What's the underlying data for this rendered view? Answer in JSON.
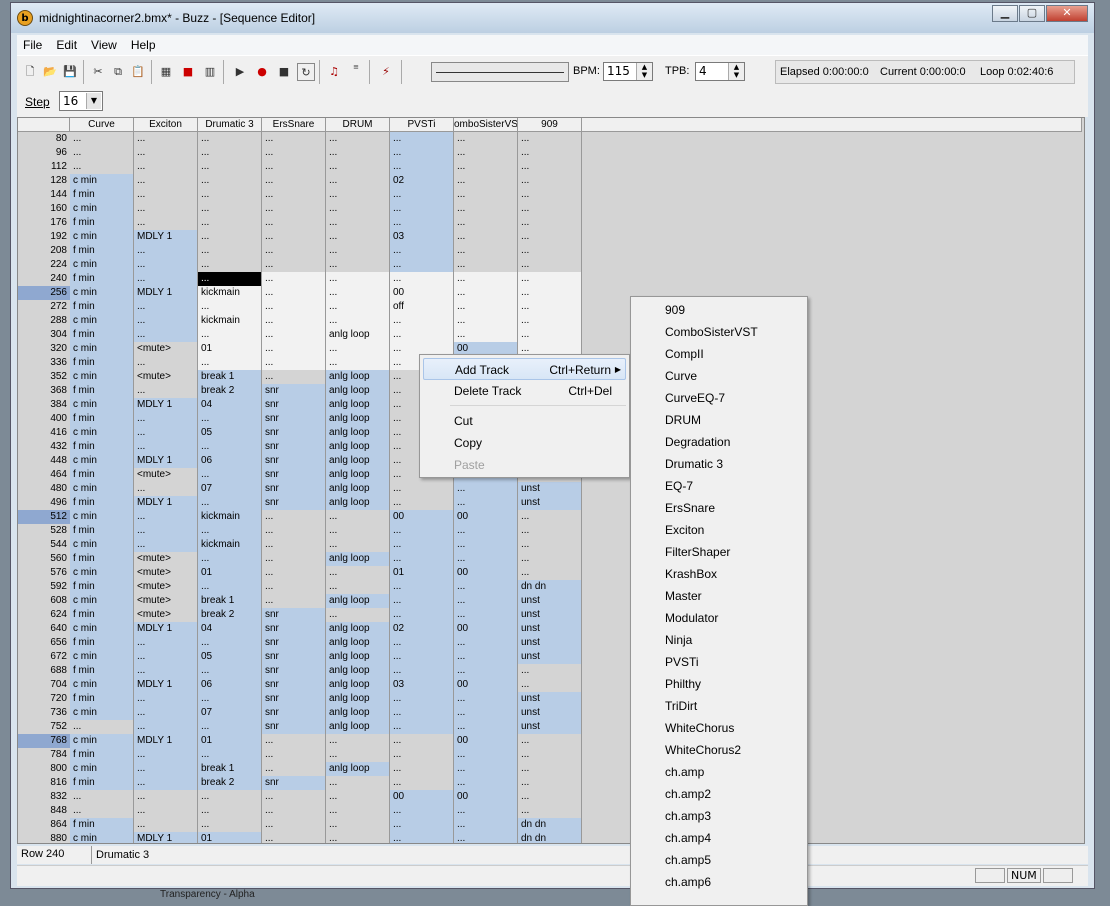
{
  "window": {
    "title": "midnightinacorner2.bmx* - Buzz - [Sequence Editor]",
    "app_icon_letter": "b",
    "minimize": "▁",
    "maximize": "▢",
    "close": "✕"
  },
  "menu": [
    "File",
    "Edit",
    "View",
    "Help"
  ],
  "toolbar": {
    "bpm_label": "BPM:",
    "bpm_value": "115",
    "tpb_label": "TPB:",
    "tpb_value": "4",
    "elapsed": "Elapsed 0:00:00:0",
    "current": "Current 0:00:00:0",
    "loop": "Loop 0:02:40:6"
  },
  "step": {
    "label": "Step",
    "value": "16"
  },
  "columns": [
    "Curve",
    "Exciton",
    "Drumatic 3",
    "ErsSnare",
    "DRUM",
    "PVSTi",
    "omboSisterVS",
    "909"
  ],
  "rows": [
    {
      "n": "80",
      "c": [
        "...",
        "...",
        "...",
        "...",
        "...",
        "...",
        "...",
        "..."
      ],
      "s": [
        "g",
        "g",
        "g",
        "g",
        "g",
        "b",
        "g",
        "g"
      ]
    },
    {
      "n": "96",
      "c": [
        "...",
        "...",
        "...",
        "...",
        "...",
        "...",
        "...",
        "..."
      ],
      "s": [
        "g",
        "g",
        "g",
        "g",
        "g",
        "b",
        "g",
        "g"
      ]
    },
    {
      "n": "112",
      "c": [
        "...",
        "...",
        "...",
        "...",
        "...",
        "...",
        "...",
        "..."
      ],
      "s": [
        "g",
        "g",
        "g",
        "g",
        "g",
        "b",
        "g",
        "g"
      ]
    },
    {
      "n": "128",
      "c": [
        "c min",
        "...",
        "...",
        "...",
        "...",
        "02",
        "...",
        "..."
      ],
      "s": [
        "b",
        "g",
        "g",
        "g",
        "g",
        "b",
        "g",
        "g"
      ]
    },
    {
      "n": "144",
      "c": [
        "f min",
        "...",
        "...",
        "...",
        "...",
        "...",
        "...",
        "..."
      ],
      "s": [
        "b",
        "g",
        "g",
        "g",
        "g",
        "b",
        "g",
        "g"
      ]
    },
    {
      "n": "160",
      "c": [
        "c min",
        "...",
        "...",
        "...",
        "...",
        "...",
        "...",
        "..."
      ],
      "s": [
        "b",
        "g",
        "g",
        "g",
        "g",
        "b",
        "g",
        "g"
      ]
    },
    {
      "n": "176",
      "c": [
        "f min",
        "...",
        "...",
        "...",
        "...",
        "...",
        "...",
        "..."
      ],
      "s": [
        "b",
        "g",
        "g",
        "g",
        "g",
        "b",
        "g",
        "g"
      ]
    },
    {
      "n": "192",
      "c": [
        "c min",
        "MDLY 1",
        "...",
        "...",
        "...",
        "03",
        "...",
        "..."
      ],
      "s": [
        "b",
        "b",
        "g",
        "g",
        "g",
        "b",
        "g",
        "g"
      ]
    },
    {
      "n": "208",
      "c": [
        "f min",
        "...",
        "...",
        "...",
        "...",
        "...",
        "...",
        "..."
      ],
      "s": [
        "b",
        "b",
        "g",
        "g",
        "g",
        "b",
        "g",
        "g"
      ]
    },
    {
      "n": "224",
      "c": [
        "c min",
        "...",
        "...",
        "...",
        "...",
        "...",
        "...",
        "..."
      ],
      "s": [
        "b",
        "b",
        "g",
        "g",
        "g",
        "b",
        "g",
        "g"
      ]
    },
    {
      "n": "240",
      "c": [
        "f min",
        "...",
        "...",
        "...",
        "...",
        "...",
        "...",
        "..."
      ],
      "s": [
        "b",
        "b",
        "x",
        "w",
        "w",
        "w",
        "w",
        "w"
      ]
    },
    {
      "n": "256",
      "c": [
        "c min",
        "MDLY 1",
        "kickmain",
        "...",
        "...",
        "00",
        "...",
        "..."
      ],
      "s": [
        "b",
        "b",
        "w",
        "w",
        "w",
        "w",
        "w",
        "w"
      ],
      "hl": true
    },
    {
      "n": "272",
      "c": [
        "f min",
        "...",
        "...",
        "...",
        "...",
        "off",
        "...",
        "..."
      ],
      "s": [
        "b",
        "b",
        "w",
        "w",
        "w",
        "w",
        "w",
        "w"
      ]
    },
    {
      "n": "288",
      "c": [
        "c min",
        "...",
        "kickmain",
        "...",
        "...",
        "...",
        "...",
        "..."
      ],
      "s": [
        "b",
        "b",
        "w",
        "w",
        "w",
        "w",
        "w",
        "w"
      ]
    },
    {
      "n": "304",
      "c": [
        "f min",
        "...",
        "...",
        "...",
        "anlg loop",
        "...",
        "...",
        "..."
      ],
      "s": [
        "b",
        "b",
        "w",
        "w",
        "w",
        "w",
        "w",
        "w"
      ]
    },
    {
      "n": "320",
      "c": [
        "c min",
        "<mute>",
        "01",
        "...",
        "...",
        "...",
        "00",
        "..."
      ],
      "s": [
        "b",
        "g",
        "w",
        "w",
        "w",
        "w",
        "b",
        "w"
      ]
    },
    {
      "n": "336",
      "c": [
        "f min",
        "...",
        "...",
        "...",
        "...",
        "...",
        "...",
        "..."
      ],
      "s": [
        "b",
        "g",
        "w",
        "w",
        "w",
        "w",
        "b",
        "w"
      ]
    },
    {
      "n": "352",
      "c": [
        "c min",
        "<mute>",
        "break 1",
        "...",
        "anlg loop",
        "...",
        "...",
        "..."
      ],
      "s": [
        "b",
        "g",
        "b",
        "g",
        "b",
        "g",
        "b",
        "g"
      ]
    },
    {
      "n": "368",
      "c": [
        "f min",
        "...",
        "break 2",
        "snr",
        "anlg loop",
        "...",
        "...",
        "..."
      ],
      "s": [
        "b",
        "g",
        "b",
        "b",
        "b",
        "g",
        "b",
        "g"
      ]
    },
    {
      "n": "384",
      "c": [
        "c min",
        "MDLY 1",
        "04",
        "snr",
        "anlg loop",
        "...",
        "...",
        "..."
      ],
      "s": [
        "b",
        "b",
        "b",
        "b",
        "b",
        "g",
        "b",
        "g"
      ]
    },
    {
      "n": "400",
      "c": [
        "f min",
        "...",
        "...",
        "snr",
        "anlg loop",
        "...",
        "...",
        "..."
      ],
      "s": [
        "b",
        "b",
        "b",
        "b",
        "b",
        "g",
        "b",
        "g"
      ]
    },
    {
      "n": "416",
      "c": [
        "c min",
        "...",
        "05",
        "snr",
        "anlg loop",
        "...",
        "...",
        "..."
      ],
      "s": [
        "b",
        "b",
        "b",
        "b",
        "b",
        "g",
        "b",
        "g"
      ]
    },
    {
      "n": "432",
      "c": [
        "f min",
        "...",
        "...",
        "snr",
        "anlg loop",
        "...",
        "...",
        "..."
      ],
      "s": [
        "b",
        "b",
        "b",
        "b",
        "b",
        "g",
        "b",
        "g"
      ]
    },
    {
      "n": "448",
      "c": [
        "c min",
        "MDLY 1",
        "06",
        "snr",
        "anlg loop",
        "...",
        "...",
        "..."
      ],
      "s": [
        "b",
        "b",
        "b",
        "b",
        "b",
        "g",
        "b",
        "g"
      ]
    },
    {
      "n": "464",
      "c": [
        "f min",
        "<mute>",
        "...",
        "snr",
        "anlg loop",
        "...",
        "...",
        "..."
      ],
      "s": [
        "b",
        "g",
        "b",
        "b",
        "b",
        "g",
        "b",
        "g"
      ]
    },
    {
      "n": "480",
      "c": [
        "c min",
        "...",
        "07",
        "snr",
        "anlg loop",
        "...",
        "...",
        "unst"
      ],
      "s": [
        "b",
        "g",
        "b",
        "b",
        "b",
        "g",
        "b",
        "b"
      ]
    },
    {
      "n": "496",
      "c": [
        "f min",
        "MDLY 1",
        "...",
        "snr",
        "anlg loop",
        "...",
        "...",
        "unst"
      ],
      "s": [
        "b",
        "b",
        "b",
        "b",
        "b",
        "g",
        "b",
        "b"
      ]
    },
    {
      "n": "512",
      "c": [
        "c min",
        "...",
        "kickmain",
        "...",
        "...",
        "00",
        "00",
        "..."
      ],
      "s": [
        "b",
        "b",
        "b",
        "g",
        "g",
        "b",
        "b",
        "g"
      ],
      "hl": true
    },
    {
      "n": "528",
      "c": [
        "f min",
        "...",
        "...",
        "...",
        "...",
        "...",
        "...",
        "..."
      ],
      "s": [
        "b",
        "b",
        "b",
        "g",
        "g",
        "b",
        "b",
        "g"
      ]
    },
    {
      "n": "544",
      "c": [
        "c min",
        "...",
        "kickmain",
        "...",
        "...",
        "...",
        "...",
        "..."
      ],
      "s": [
        "b",
        "b",
        "b",
        "g",
        "g",
        "b",
        "b",
        "g"
      ]
    },
    {
      "n": "560",
      "c": [
        "f min",
        "<mute>",
        "...",
        "...",
        "anlg loop",
        "...",
        "...",
        "..."
      ],
      "s": [
        "b",
        "g",
        "b",
        "g",
        "b",
        "b",
        "b",
        "g"
      ]
    },
    {
      "n": "576",
      "c": [
        "c min",
        "<mute>",
        "01",
        "...",
        "...",
        "01",
        "00",
        "..."
      ],
      "s": [
        "b",
        "g",
        "b",
        "g",
        "g",
        "b",
        "b",
        "g"
      ]
    },
    {
      "n": "592",
      "c": [
        "f min",
        "<mute>",
        "...",
        "...",
        "...",
        "...",
        "...",
        "dn dn"
      ],
      "s": [
        "b",
        "g",
        "b",
        "g",
        "g",
        "b",
        "b",
        "b"
      ]
    },
    {
      "n": "608",
      "c": [
        "c min",
        "<mute>",
        "break 1",
        "...",
        "anlg loop",
        "...",
        "...",
        "unst"
      ],
      "s": [
        "b",
        "g",
        "b",
        "g",
        "b",
        "b",
        "b",
        "b"
      ]
    },
    {
      "n": "624",
      "c": [
        "f min",
        "<mute>",
        "break 2",
        "snr",
        "...",
        "...",
        "...",
        "unst"
      ],
      "s": [
        "b",
        "g",
        "b",
        "b",
        "g",
        "b",
        "b",
        "b"
      ]
    },
    {
      "n": "640",
      "c": [
        "c min",
        "MDLY 1",
        "04",
        "snr",
        "anlg loop",
        "02",
        "00",
        "unst"
      ],
      "s": [
        "b",
        "b",
        "b",
        "b",
        "b",
        "b",
        "b",
        "b"
      ]
    },
    {
      "n": "656",
      "c": [
        "f min",
        "...",
        "...",
        "snr",
        "anlg loop",
        "...",
        "...",
        "unst"
      ],
      "s": [
        "b",
        "b",
        "b",
        "b",
        "b",
        "b",
        "b",
        "b"
      ]
    },
    {
      "n": "672",
      "c": [
        "c min",
        "...",
        "05",
        "snr",
        "anlg loop",
        "...",
        "...",
        "unst"
      ],
      "s": [
        "b",
        "b",
        "b",
        "b",
        "b",
        "b",
        "b",
        "b"
      ]
    },
    {
      "n": "688",
      "c": [
        "f min",
        "...",
        "...",
        "snr",
        "anlg loop",
        "...",
        "...",
        "..."
      ],
      "s": [
        "b",
        "b",
        "b",
        "b",
        "b",
        "b",
        "b",
        "g"
      ]
    },
    {
      "n": "704",
      "c": [
        "c min",
        "MDLY 1",
        "06",
        "snr",
        "anlg loop",
        "03",
        "00",
        "..."
      ],
      "s": [
        "b",
        "b",
        "b",
        "b",
        "b",
        "b",
        "b",
        "g"
      ]
    },
    {
      "n": "720",
      "c": [
        "f min",
        "...",
        "...",
        "snr",
        "anlg loop",
        "...",
        "...",
        "unst"
      ],
      "s": [
        "b",
        "b",
        "b",
        "b",
        "b",
        "b",
        "b",
        "b"
      ]
    },
    {
      "n": "736",
      "c": [
        "c min",
        "...",
        "07",
        "snr",
        "anlg loop",
        "...",
        "...",
        "unst"
      ],
      "s": [
        "b",
        "b",
        "b",
        "b",
        "b",
        "b",
        "b",
        "b"
      ]
    },
    {
      "n": "752",
      "c": [
        "...",
        "...",
        "...",
        "snr",
        "anlg loop",
        "...",
        "...",
        "unst"
      ],
      "s": [
        "g",
        "b",
        "b",
        "b",
        "b",
        "b",
        "b",
        "b"
      ]
    },
    {
      "n": "768",
      "c": [
        "c min",
        "MDLY 1",
        "01",
        "...",
        "...",
        "...",
        "00",
        "..."
      ],
      "s": [
        "b",
        "b",
        "b",
        "g",
        "g",
        "g",
        "b",
        "g"
      ],
      "hl": true
    },
    {
      "n": "784",
      "c": [
        "f min",
        "...",
        "...",
        "...",
        "...",
        "...",
        "...",
        "..."
      ],
      "s": [
        "b",
        "b",
        "b",
        "g",
        "g",
        "g",
        "b",
        "g"
      ]
    },
    {
      "n": "800",
      "c": [
        "c min",
        "...",
        "break 1",
        "...",
        "anlg loop",
        "...",
        "...",
        "..."
      ],
      "s": [
        "b",
        "b",
        "b",
        "g",
        "b",
        "g",
        "b",
        "g"
      ]
    },
    {
      "n": "816",
      "c": [
        "f min",
        "...",
        "break 2",
        "snr",
        "...",
        "...",
        "...",
        "..."
      ],
      "s": [
        "b",
        "b",
        "b",
        "b",
        "g",
        "g",
        "b",
        "g"
      ]
    },
    {
      "n": "832",
      "c": [
        "...",
        "...",
        "...",
        "...",
        "...",
        "00",
        "00",
        "..."
      ],
      "s": [
        "g",
        "g",
        "g",
        "g",
        "g",
        "b",
        "b",
        "g"
      ]
    },
    {
      "n": "848",
      "c": [
        "...",
        "...",
        "...",
        "...",
        "...",
        "...",
        "...",
        "..."
      ],
      "s": [
        "g",
        "g",
        "g",
        "g",
        "g",
        "b",
        "b",
        "g"
      ]
    },
    {
      "n": "864",
      "c": [
        "f min",
        "...",
        "...",
        "...",
        "...",
        "...",
        "...",
        "dn dn"
      ],
      "s": [
        "b",
        "g",
        "g",
        "g",
        "g",
        "b",
        "b",
        "b"
      ]
    },
    {
      "n": "880",
      "c": [
        "c min",
        "MDLY 1",
        "01",
        "...",
        "...",
        "...",
        "...",
        "dn dn"
      ],
      "s": [
        "b",
        "b",
        "b",
        "g",
        "g",
        "b",
        "b",
        "b"
      ]
    }
  ],
  "status": {
    "row": "Row 240",
    "machine": "Drumatic 3",
    "num": "NUM"
  },
  "context_menu": {
    "add_track": "Add Track",
    "add_track_shortcut": "Ctrl+Return",
    "delete_track": "Delete Track",
    "delete_track_shortcut": "Ctrl+Del",
    "cut": "Cut",
    "copy": "Copy",
    "paste": "Paste"
  },
  "submenu": [
    "909",
    "ComboSisterVST",
    "CompII",
    "Curve",
    "CurveEQ-7",
    "DRUM",
    "Degradation",
    "Drumatic 3",
    "EQ-7",
    "ErsSnare",
    "Exciton",
    "FilterShaper",
    "KrashBox",
    "Master",
    "Modulator",
    "Ninja",
    "PVSTi",
    "Philthy",
    "TriDirt",
    "WhiteChorus",
    "WhiteChorus2",
    "ch.amp",
    "ch.amp2",
    "ch.amp3",
    "ch.amp4",
    "ch.amp5",
    "ch.amp6"
  ],
  "taskbar": "Transparency - Alpha"
}
